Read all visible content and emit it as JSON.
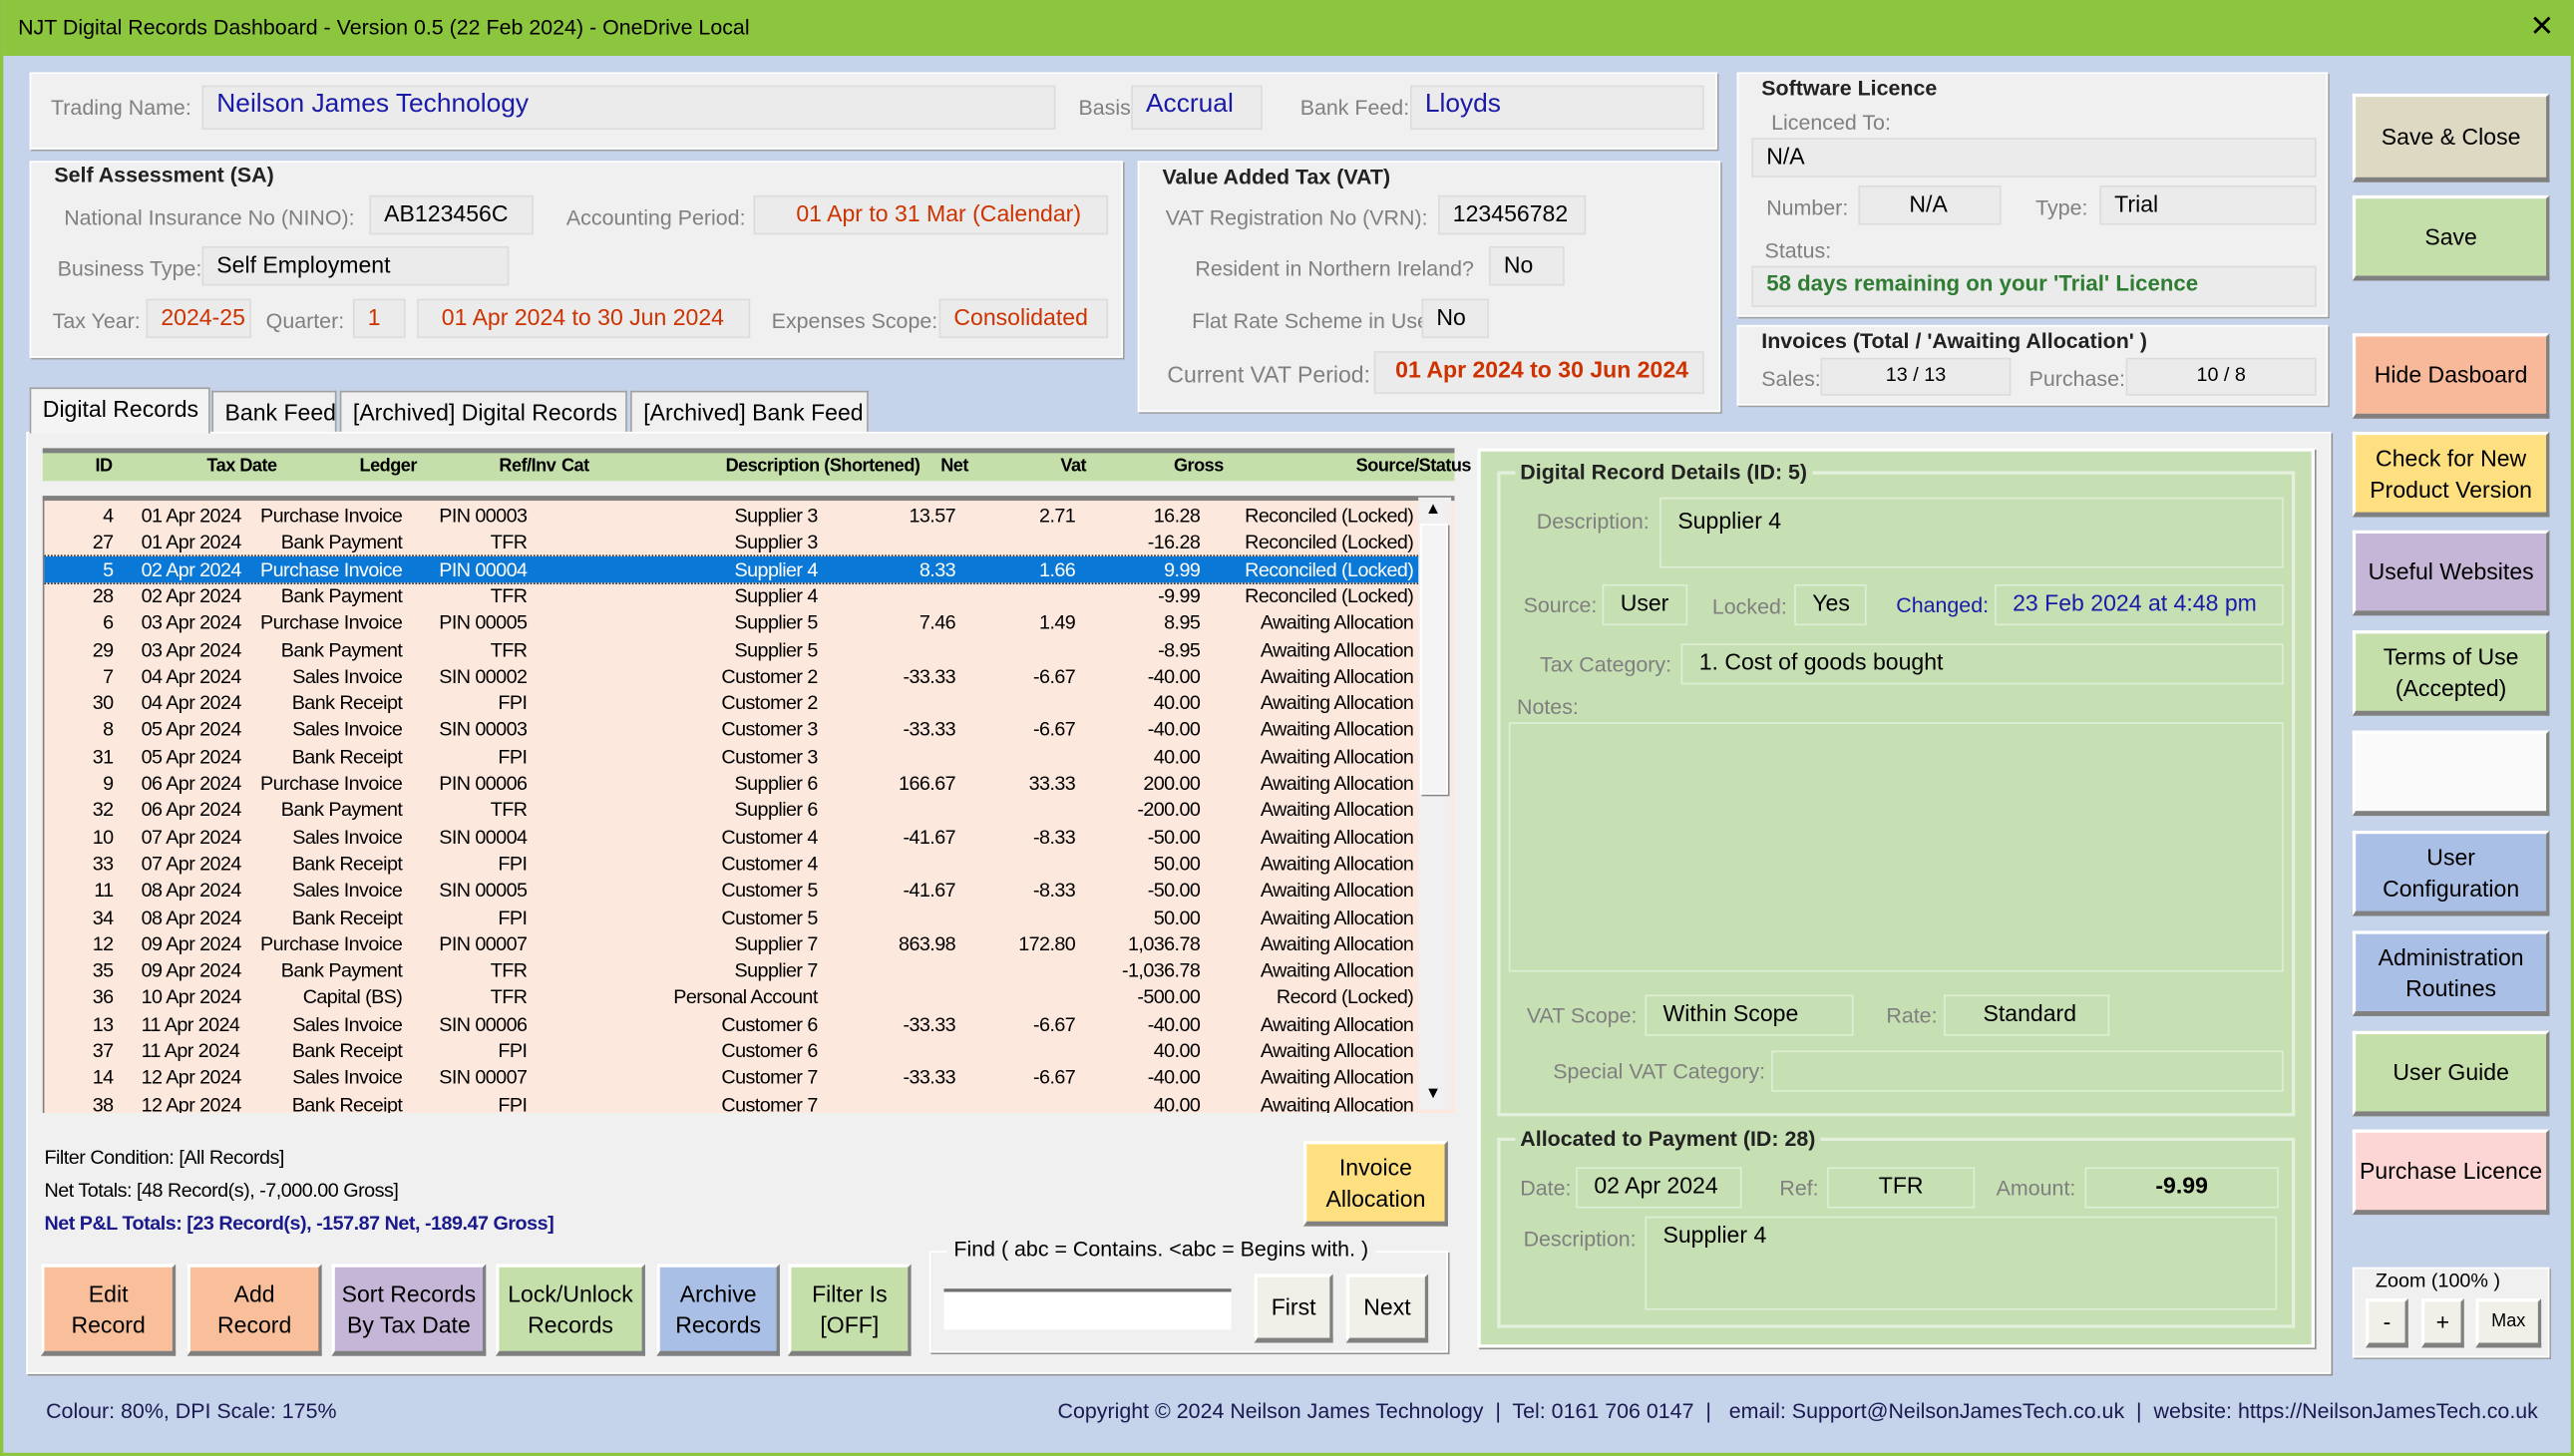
{
  "window": {
    "title": "NJT Digital Records Dashboard - Version 0.5 (22 Feb 2024) - OneDrive Local",
    "close_icon": "close-icon"
  },
  "business": {
    "trading_name_label": "Trading Name:",
    "trading_name": "Neilson James Technology",
    "basis_label": "Basis:",
    "basis": "Accrual",
    "bank_feed_label": "Bank Feed:",
    "bank_feed": "Lloyds"
  },
  "sa": {
    "title": "Self Assessment (SA)",
    "nino_label": "National Insurance No (NINO):",
    "nino": "AB123456C",
    "period_label": "Accounting Period:",
    "period": "01 Apr to 31 Mar (Calendar)",
    "business_type_label": "Business Type:",
    "business_type": "Self Employment",
    "tax_year_label": "Tax Year:",
    "tax_year": "2024-25",
    "quarter_label": "Quarter:",
    "quarter": "1",
    "quarter_range": "01 Apr 2024 to 30 Jun 2024",
    "expenses_label": "Expenses Scope:",
    "expenses": "Consolidated"
  },
  "vat": {
    "title": "Value Added Tax (VAT)",
    "vrn_label": "VAT Registration No (VRN):",
    "vrn": "123456782",
    "ni_label": "Resident in Northern Ireland?",
    "ni": "No",
    "frs_label": "Flat Rate Scheme in Use?",
    "frs": "No",
    "period_label": "Current VAT Period:",
    "period": "01 Apr 2024 to 30 Jun 2024"
  },
  "licence": {
    "title": "Software Licence",
    "licenced_to_label": "Licenced To:",
    "licenced_to": "N/A",
    "number_label": "Number:",
    "number": "N/A",
    "type_label": "Type:",
    "type": "Trial",
    "status_label": "Status:",
    "status": "58 days remaining on your 'Trial' Licence"
  },
  "invoices": {
    "title": "Invoices (Total / 'Awaiting Allocation' )",
    "sales_label": "Sales:",
    "sales": "13 / 13",
    "purchase_label": "Purchase:",
    "purchase": "10 / 8"
  },
  "side_buttons": [
    "Save & Close",
    "Save",
    "Hide Dasboard",
    "Check for New Product Version",
    "Useful Websites",
    "Terms of Use (Accepted)",
    "",
    "User Configuration",
    "Administration Routines",
    "User Guide",
    "Purchase Licence"
  ],
  "zoom": {
    "title": "Zoom (100% )",
    "minus": "-",
    "plus": "+",
    "max": "Max"
  },
  "tabs": [
    "Digital Records",
    "Bank Feed",
    "[Archived] Digital Records",
    "[Archived] Bank Feed"
  ],
  "table": {
    "columns": [
      "ID",
      "Tax Date",
      "Ledger",
      "Ref/Inv",
      "Cat",
      "Description (Shortened)",
      "Net",
      "Vat",
      "Gross",
      "Source/Status"
    ],
    "selected_index": 2,
    "rows": [
      [
        "4",
        "01 Apr 2024",
        "Purchase Invoice",
        "PIN 00003",
        "",
        "Supplier 3",
        "13.57",
        "2.71",
        "16.28",
        "Reconciled (Locked)"
      ],
      [
        "27",
        "01 Apr 2024",
        "Bank Payment",
        "TFR",
        "",
        "Supplier 3",
        "",
        "",
        "-16.28",
        "Reconciled (Locked)"
      ],
      [
        "5",
        "02 Apr 2024",
        "Purchase Invoice",
        "PIN 00004",
        "",
        "Supplier 4",
        "8.33",
        "1.66",
        "9.99",
        "Reconciled (Locked)"
      ],
      [
        "28",
        "02 Apr 2024",
        "Bank Payment",
        "TFR",
        "",
        "Supplier 4",
        "",
        "",
        "-9.99",
        "Reconciled (Locked)"
      ],
      [
        "6",
        "03 Apr 2024",
        "Purchase Invoice",
        "PIN 00005",
        "",
        "Supplier 5",
        "7.46",
        "1.49",
        "8.95",
        "Awaiting Allocation"
      ],
      [
        "29",
        "03 Apr 2024",
        "Bank Payment",
        "TFR",
        "",
        "Supplier 5",
        "",
        "",
        "-8.95",
        "Awaiting Allocation"
      ],
      [
        "7",
        "04 Apr 2024",
        "Sales Invoice",
        "SIN 00002",
        "",
        "Customer 2",
        "-33.33",
        "-6.67",
        "-40.00",
        "Awaiting Allocation"
      ],
      [
        "30",
        "04 Apr 2024",
        "Bank Receipt",
        "FPI",
        "",
        "Customer 2",
        "",
        "",
        "40.00",
        "Awaiting Allocation"
      ],
      [
        "8",
        "05 Apr 2024",
        "Sales Invoice",
        "SIN 00003",
        "",
        "Customer 3",
        "-33.33",
        "-6.67",
        "-40.00",
        "Awaiting Allocation"
      ],
      [
        "31",
        "05 Apr 2024",
        "Bank Receipt",
        "FPI",
        "",
        "Customer 3",
        "",
        "",
        "40.00",
        "Awaiting Allocation"
      ],
      [
        "9",
        "06 Apr 2024",
        "Purchase Invoice",
        "PIN 00006",
        "",
        "Supplier 6",
        "166.67",
        "33.33",
        "200.00",
        "Awaiting Allocation"
      ],
      [
        "32",
        "06 Apr 2024",
        "Bank Payment",
        "TFR",
        "",
        "Supplier 6",
        "",
        "",
        "-200.00",
        "Awaiting Allocation"
      ],
      [
        "10",
        "07 Apr 2024",
        "Sales Invoice",
        "SIN 00004",
        "",
        "Customer 4",
        "-41.67",
        "-8.33",
        "-50.00",
        "Awaiting Allocation"
      ],
      [
        "33",
        "07 Apr 2024",
        "Bank Receipt",
        "FPI",
        "",
        "Customer 4",
        "",
        "",
        "50.00",
        "Awaiting Allocation"
      ],
      [
        "11",
        "08 Apr 2024",
        "Sales Invoice",
        "SIN 00005",
        "",
        "Customer 5",
        "-41.67",
        "-8.33",
        "-50.00",
        "Awaiting Allocation"
      ],
      [
        "34",
        "08 Apr 2024",
        "Bank Receipt",
        "FPI",
        "",
        "Customer 5",
        "",
        "",
        "50.00",
        "Awaiting Allocation"
      ],
      [
        "12",
        "09 Apr 2024",
        "Purchase Invoice",
        "PIN 00007",
        "",
        "Supplier 7",
        "863.98",
        "172.80",
        "1,036.78",
        "Awaiting Allocation"
      ],
      [
        "35",
        "09 Apr 2024",
        "Bank Payment",
        "TFR",
        "",
        "Supplier 7",
        "",
        "",
        "-1,036.78",
        "Awaiting Allocation"
      ],
      [
        "36",
        "10 Apr 2024",
        "Capital (BS)",
        "TFR",
        "",
        "Personal Account",
        "",
        "",
        "-500.00",
        "Record (Locked)"
      ],
      [
        "13",
        "11 Apr 2024",
        "Sales Invoice",
        "SIN 00006",
        "",
        "Customer 6",
        "-33.33",
        "-6.67",
        "-40.00",
        "Awaiting Allocation"
      ],
      [
        "37",
        "11 Apr 2024",
        "Bank Receipt",
        "FPI",
        "",
        "Customer 6",
        "",
        "",
        "40.00",
        "Awaiting Allocation"
      ],
      [
        "14",
        "12 Apr 2024",
        "Sales Invoice",
        "SIN 00007",
        "",
        "Customer 7",
        "-33.33",
        "-6.67",
        "-40.00",
        "Awaiting Allocation"
      ],
      [
        "38",
        "12 Apr 2024",
        "Bank Receipt",
        "FPI",
        "",
        "Customer 7",
        "",
        "",
        "40.00",
        "Awaiting Allocation"
      ]
    ]
  },
  "summary": {
    "filter": "Filter Condition:  [All Records]",
    "net_totals": "Net Totals: [48 Record(s),  -7,000.00 Gross]",
    "pl_totals": "Net P&L Totals: [23 Record(s),  -157.87 Net,  -189.47 Gross]"
  },
  "actions": {
    "invoice_allocation": "Invoice Allocation",
    "edit": "Edit Record",
    "add": "Add Record",
    "sort": "Sort Records By Tax Date",
    "lock": "Lock/Unlock Records",
    "archive": "Archive Records",
    "filter": "Filter Is [OFF]"
  },
  "find": {
    "title": "Find ( abc = Contains.  <abc = Begins with. )",
    "value": "",
    "first": "First",
    "next": "Next"
  },
  "details": {
    "title": "Digital Record Details (ID: 5)",
    "description_label": "Description:",
    "description": "Supplier 4",
    "source_label": "Source:",
    "source": "User",
    "locked_label": "Locked:",
    "locked": "Yes",
    "changed_label": "Changed:",
    "changed": "23 Feb 2024 at 4:48 pm",
    "tax_category_label": "Tax Category:",
    "tax_category": "1. Cost of goods bought",
    "notes_label": "Notes:",
    "notes": "",
    "vat_scope_label": "VAT Scope:",
    "vat_scope": "Within Scope",
    "rate_label": "Rate:",
    "rate": "Standard",
    "special_vat_label": "Special VAT Category:",
    "special_vat": ""
  },
  "allocation": {
    "title": "Allocated to Payment (ID: 28)",
    "date_label": "Date:",
    "date": "02 Apr 2024",
    "ref_label": "Ref:",
    "ref": "TFR",
    "amount_label": "Amount:",
    "amount": "-9.99",
    "description_label": "Description:",
    "description": "Supplier 4"
  },
  "footer": {
    "colour": "Colour: 80%, DPI Scale: 175%",
    "copyright": "Copyright © 2024 Neilson James Technology  |  Tel: 0161 706 0147  |   email: Support@NeilsonJamesTech.co.uk  |  website: https://NeilsonJamesTech.co.uk"
  },
  "colors": {
    "title_bar": "#8cc63f",
    "background": "#c5d3eb",
    "row": "#fde8dd",
    "selected_row": "#0a78d7",
    "header": "#c4dfaa",
    "details_panel": "#c6e0b4"
  }
}
